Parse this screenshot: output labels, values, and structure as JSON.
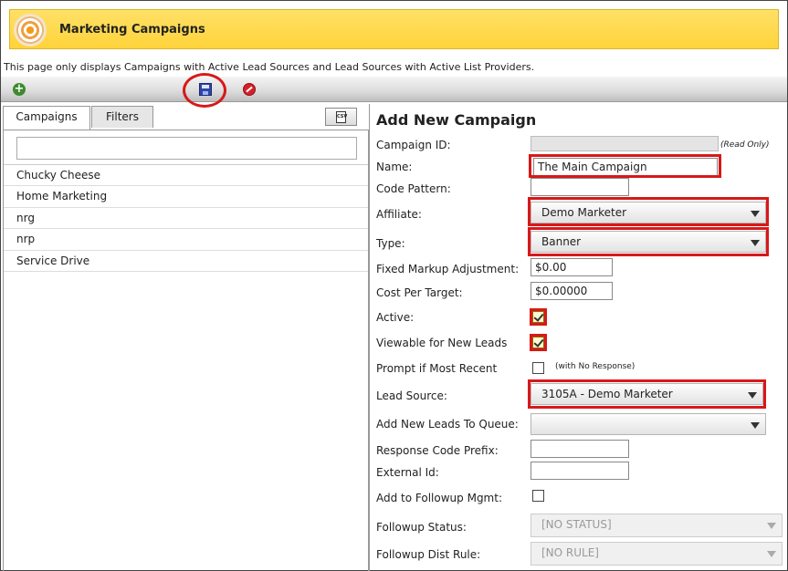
{
  "header": {
    "title": "Marketing Campaigns",
    "logo_icon": "target-icon"
  },
  "notice": "This page only displays Campaigns with Active Lead Sources and Lead Sources with Active List Providers.",
  "toolbar": {
    "add_icon": "plus-icon",
    "save_icon": "floppy-disk-icon",
    "cancel_icon": "no-entry-icon"
  },
  "tabs": [
    {
      "label": "Campaigns",
      "active": true
    },
    {
      "label": "Filters",
      "active": false
    }
  ],
  "csv_button": {
    "icon": "csv-file-icon",
    "label": "CSV"
  },
  "search": {
    "value": "",
    "placeholder": ""
  },
  "campaigns": [
    "Chucky Cheese",
    "Home Marketing",
    "nrg",
    "nrp",
    "Service Drive"
  ],
  "form": {
    "title": "Add New Campaign",
    "campaign_id": {
      "label": "Campaign ID:",
      "value": "",
      "note": "(Read Only)"
    },
    "name": {
      "label": "Name:",
      "value": "The Main Campaign"
    },
    "code_pattern": {
      "label": "Code Pattern:",
      "value": ""
    },
    "affiliate": {
      "label": "Affiliate:",
      "value": "Demo Marketer"
    },
    "type": {
      "label": "Type:",
      "value": "Banner"
    },
    "fixed_markup": {
      "label": "Fixed Markup Adjustment:",
      "value": "$0.00"
    },
    "cost_per_target": {
      "label": "Cost Per Target:",
      "value": "$0.00000"
    },
    "active": {
      "label": "Active:",
      "checked": true
    },
    "viewable": {
      "label": "Viewable for New Leads",
      "checked": true
    },
    "prompt_recent": {
      "label": "Prompt if Most Recent",
      "checked": false,
      "note": "(with No Response)"
    },
    "lead_source": {
      "label": "Lead Source:",
      "value": "3105A - Demo Marketer"
    },
    "add_to_queue": {
      "label": "Add New Leads To Queue:",
      "value": ""
    },
    "response_prefix": {
      "label": "Response Code Prefix:",
      "value": ""
    },
    "external_id": {
      "label": "External Id:",
      "value": ""
    },
    "followup_mgmt": {
      "label": "Add to Followup Mgmt:",
      "checked": false
    },
    "followup_status": {
      "label": "Followup Status:",
      "value": "[NO STATUS]"
    },
    "followup_dist": {
      "label": "Followup Dist Rule:",
      "value": "[NO RULE]"
    }
  },
  "colors": {
    "header_bg": "#ffd33a",
    "highlight_red": "#d81818"
  }
}
